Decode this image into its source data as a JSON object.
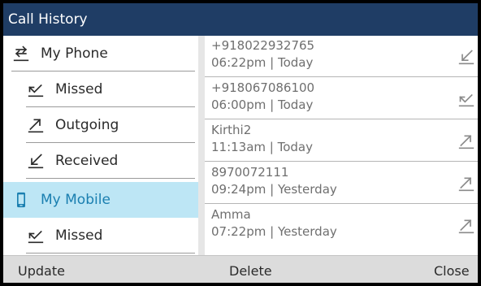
{
  "title": "Call History",
  "sidebar": {
    "items": [
      {
        "label": "My Phone",
        "icon": "all-calls-icon",
        "level": 1,
        "selected": false
      },
      {
        "label": "Missed",
        "icon": "missed-call-icon",
        "level": 2,
        "selected": false
      },
      {
        "label": "Outgoing",
        "icon": "outgoing-call-icon",
        "level": 2,
        "selected": false
      },
      {
        "label": "Received",
        "icon": "received-call-icon",
        "level": 2,
        "selected": false
      },
      {
        "label": "My Mobile",
        "icon": "mobile-phone-icon",
        "level": 1,
        "selected": true
      },
      {
        "label": "Missed",
        "icon": "missed-call-icon",
        "level": 2,
        "selected": false
      }
    ]
  },
  "calls": [
    {
      "name": "+918022932765",
      "time": "06:22pm | Today",
      "icon": "received-call-icon"
    },
    {
      "name": "+918067086100",
      "time": "06:00pm | Today",
      "icon": "missed-call-icon"
    },
    {
      "name": "Kirthi2",
      "time": "11:13am | Today",
      "icon": "outgoing-call-icon"
    },
    {
      "name": "8970072111",
      "time": "09:24pm | Yesterday",
      "icon": "outgoing-call-icon"
    },
    {
      "name": "Amma",
      "time": "07:22pm | Yesterday",
      "icon": "outgoing-call-icon"
    }
  ],
  "softkeys": {
    "update": "Update",
    "delete": "Delete",
    "close": "Close"
  },
  "colors": {
    "titlebar": "#1f3d65",
    "selected_bg": "#bde6f5",
    "selected_text": "#1a7fb0",
    "softkey_bar": "#dcdcdc"
  }
}
